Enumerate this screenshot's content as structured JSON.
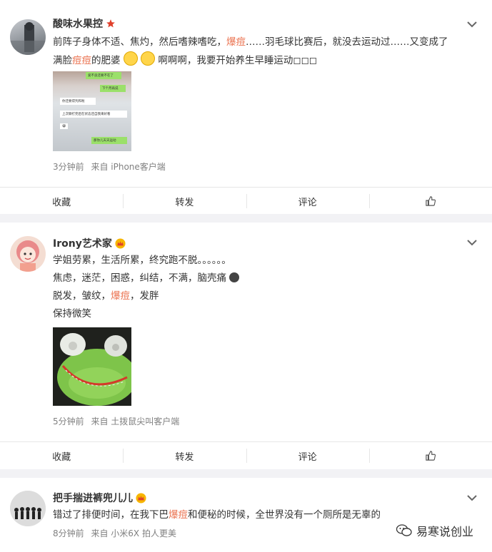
{
  "colors": {
    "highlight": "#eb7350",
    "accent_star": "#e0412c",
    "separator": "#f2f2f5"
  },
  "posts": [
    {
      "username": "酸味水果控",
      "badge_icon": "star-badge-icon",
      "text_lines": [
        [
          "前阵子身体不适、焦灼，然后嗜辣嗜吃，",
          {
            "hl": "爆痘"
          },
          "……羽毛球比赛后，就没去运动过……又变成了"
        ],
        [
          "满脸",
          {
            "hl": "痘痘"
          },
          "的肥婆",
          {
            "emoji": "sweat-smile"
          },
          {
            "emoji": "grin"
          },
          "啊啊啊，我要开始养生早睡运动◻◻◻"
        ]
      ],
      "chat_bubbles": [
        "爱不良还要不在了",
        "下个月再说",
        "你还要得凭和啦",
        "上次聊打完后在状态还自我来好看",
        "😀",
        "那你儿天天运动"
      ],
      "time": "3分钟前",
      "source": "来自 iPhone客户端"
    },
    {
      "username": "Irony艺术家",
      "badge_icon": "crown-badge-icon",
      "text_lines": [
        [
          "学姐劳累，生活所累，终究跑不脱。。。。。。"
        ],
        [
          "焦虑，迷茫，困惑，纠结，不满，脑壳痛",
          {
            "emoji": "frown"
          }
        ],
        [
          "脱发，皱纹，",
          {
            "hl": "爆痘"
          },
          "，发胖"
        ],
        [
          "保持微笑"
        ]
      ],
      "time": "5分钟前",
      "source": "来自 土拨鼠尖叫客户端"
    },
    {
      "username": "把手揣进裤兜儿儿",
      "badge_icon": "crown-badge-icon",
      "text_lines": [
        [
          "错过了排便时间，在我下巴",
          {
            "hl": "爆痘"
          },
          "和便秘的时候，全世界没有一个厕所是无辜的"
        ]
      ],
      "time": "8分钟前",
      "source": "来自 小米6X 拍人更美"
    }
  ],
  "actions": {
    "collect": "收藏",
    "repost": "转发",
    "comment": "评论"
  },
  "watermark": "易寒说创业"
}
